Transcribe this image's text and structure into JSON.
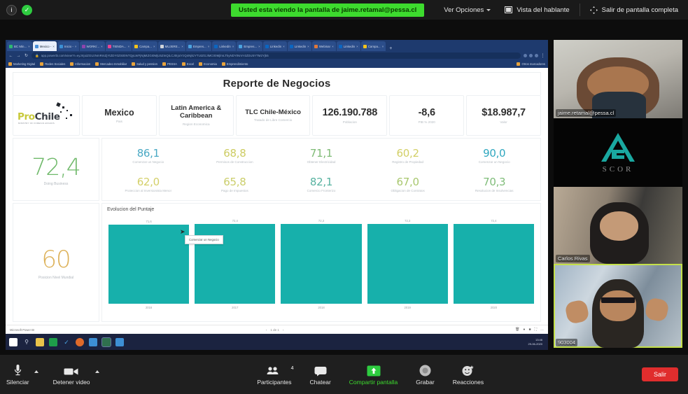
{
  "topbar": {
    "share_banner": "Usted esta viendo la pantalla de jaime.retamal@pessa.cl",
    "view_options": "Ver Opciones",
    "speaker_view": "Vista del hablante",
    "exit_fullscreen": "Salir de pantalla completa"
  },
  "browser": {
    "tabs": [
      {
        "title": "BC Min...",
        "color": "#2eb872"
      },
      {
        "title": "Mexico -",
        "color": "#4a90d9"
      },
      {
        "title": "Inicio -",
        "color": "#3b8fd4"
      },
      {
        "title": "WORK/...",
        "color": "#8e44ad"
      },
      {
        "title": "TIENDA...",
        "color": "#e84393"
      },
      {
        "title": "Campa...",
        "color": "#f2c21b"
      },
      {
        "title": "MUJERE...",
        "color": "#d0d4da"
      },
      {
        "title": "Empres...",
        "color": "#4aa3e0"
      },
      {
        "title": "Linkedin",
        "color": "#0a66c2"
      },
      {
        "title": "Empres...",
        "color": "#4aa3e0"
      },
      {
        "title": "Linkedin",
        "color": "#0a66c2"
      },
      {
        "title": "Linkedin",
        "color": "#0a66c2"
      },
      {
        "title": "Webinar",
        "color": "#e0783a"
      },
      {
        "title": "Linkedin",
        "color": "#0a66c2"
      },
      {
        "title": "Campa...",
        "color": "#f2c21b"
      }
    ],
    "url": "app.powerbi.com/view?r=eyJrIjoiZGUzNmRmZjYtZDY0ZS00NTQyLWFjNjMtZGI0MjU5ZmQiLCJ0IjoiYzQ4NjkzYTUtZGJiMC00MjlmLTkyNDYtNmY4ZDU5YTM2Yjk5",
    "bookmarks": [
      "Marketing Digital",
      "Redes Sociales",
      "Informacion",
      "Mercadeo Inmobiliar",
      "Salud y pension",
      "PESSA",
      "Excel",
      "Economia",
      "Emprendimiento"
    ],
    "bookmark_right": "Otros marcadores"
  },
  "report": {
    "title": "Reporte de Negocios",
    "logo": {
      "prefix": "Pro",
      "suffix": "Chile",
      "tagline": "MINISTRY OF FOREIGN AFFAIRS"
    },
    "header_cards": [
      {
        "value": "Mexico",
        "label": "Pais"
      },
      {
        "value": "Latin America & Caribbean",
        "label": "Region Economica"
      },
      {
        "value": "TLC Chile-México",
        "label": "Tratado de Libre Comercio"
      },
      {
        "value": "126.190.788",
        "label": "Poblacion"
      },
      {
        "value": "-8,6",
        "label": "PIB % 2020"
      },
      {
        "value": "$18.987,7",
        "label": "Valor"
      }
    ],
    "main_score": {
      "value": "72,4",
      "label": "Doing Business",
      "color": "#6fb96a"
    },
    "position": {
      "value": "60",
      "label": "Posicion Nivel Mundial",
      "color": "#ddb158"
    },
    "indicators": [
      {
        "value": "86,1",
        "label": "Comenzar un Negocio",
        "color": "#4aa9c4"
      },
      {
        "value": "68,8",
        "label": "Permisos de Construccion",
        "color": "#cdcc63"
      },
      {
        "value": "71,1",
        "label": "Obtener Electricidad",
        "color": "#7fbb76"
      },
      {
        "value": "60,2",
        "label": "Registro de Propiedad",
        "color": "#d2cf66"
      },
      {
        "value": "90,0",
        "label": "Comenzar un Negocio",
        "color": "#2fa7bf"
      },
      {
        "value": "62,0",
        "label": "Proteccion al Inversionista Menor",
        "color": "#d4d06a"
      },
      {
        "value": "65,8",
        "label": "Pago de Impuestos",
        "color": "#cbce6b"
      },
      {
        "value": "82,1",
        "label": "Comercio Fronterizo",
        "color": "#57b2a0"
      },
      {
        "value": "67,0",
        "label": "Obligacion de Contratos",
        "color": "#a8c76e"
      },
      {
        "value": "70,3",
        "label": "Resolucion de Insolvencias",
        "color": "#80bd7a"
      }
    ],
    "tooltip": "Comenzar un Negocio",
    "chart_data": {
      "type": "bar",
      "title": "Evolucion del Puntaje",
      "categories": [
        "2016",
        "2017",
        "2018",
        "2019",
        "2020"
      ],
      "values": [
        71.6,
        72.4,
        72.3,
        72.3,
        72.4
      ],
      "value_labels": [
        "71,6",
        "72,4",
        "72,3",
        "72,3",
        "72,4"
      ],
      "xlabel": "",
      "ylabel": "",
      "ylim": [
        0,
        75
      ],
      "series_color": "#17b0ab",
      "grid": false,
      "legend": "none"
    },
    "footer": {
      "brand": "Microsoft Power BI",
      "page_indicator": "1 de 1"
    },
    "taskbar": {
      "clock_time": "13:46",
      "clock_date": "29-06-2020"
    }
  },
  "tiles": [
    {
      "name": "jaime.retamal@pessa.cl",
      "sub": "",
      "active": false
    },
    {
      "name": "SCOR",
      "sub": "",
      "active": false
    },
    {
      "name": "Carlos Rivas",
      "sub": "",
      "active": false
    },
    {
      "name": "903004",
      "sub": "",
      "active": true
    }
  ],
  "toolbar": {
    "mute": "Silenciar",
    "stop_video": "Detener video",
    "participants": "Participantes",
    "participants_count": "4",
    "chat": "Chatear",
    "share_screen": "Compartir pantalla",
    "record": "Grabar",
    "reactions": "Reacciones",
    "leave": "Salir"
  }
}
